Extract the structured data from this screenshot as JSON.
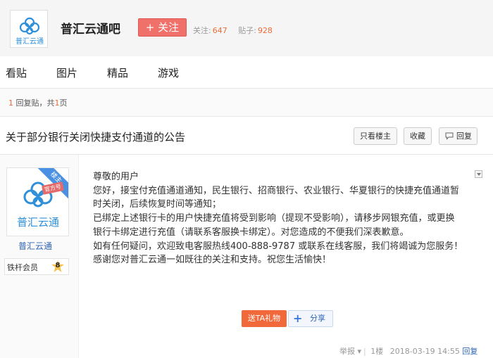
{
  "header": {
    "logo_text": "普汇云通",
    "forum_name": "普汇云通吧",
    "follow_label": "+ 关注",
    "followers_label": "关注:",
    "followers_count": "647",
    "posts_label": "贴子:",
    "posts_count": "928"
  },
  "nav": {
    "items": [
      "看贴",
      "图片",
      "精品",
      "游戏"
    ]
  },
  "pager": {
    "count": "1",
    "text_a": " 回复贴，共",
    "pages": "1",
    "text_b": "页"
  },
  "thread": {
    "title": "关于部分银行关闭快捷支付通道的公告",
    "only_op_label": "只看楼主",
    "favorite_label": "收藏",
    "reply_label": "回复"
  },
  "post": {
    "author": {
      "name": "普汇云通",
      "ribbon": "楼主",
      "official_tag": "官方号",
      "logo_text": "普汇云通",
      "level_name": "铁杆会员",
      "level_num": "8"
    },
    "lines": [
      "尊敬的用户",
      "您好，接宝付充值通道通知，民生银行、招商银行、农业银行、华夏银行的快捷充值通道暂",
      "时关闭，后续恢复时间等通知；",
      "已绑定上述银行卡的用户快捷充值将受到影响（提现不受影响），请移步网银充值，或更换",
      "银行卡绑定进行充值（请联系客服换卡绑定）。对您造成的不便我们深表歉意。",
      "如有任何疑问，欢迎致电客服热线400-888-9787 或联系在线客服，我们将竭诚为您服务！",
      "感谢您对普汇云通一如既往的关注和支持。祝您生活愉快！"
    ],
    "gift_label": "送TA礼物",
    "share_label": "分享",
    "report_label": "举报",
    "floor": "1楼",
    "datetime": "2018-03-19 14:55",
    "reply_link": "回复"
  },
  "colors": {
    "accent": "#f0706a",
    "link": "#2e64b4",
    "highlight": "#e86c39"
  }
}
